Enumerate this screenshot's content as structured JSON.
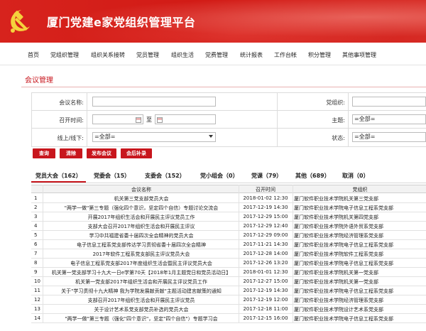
{
  "header": {
    "title": "厦门党建e家党组织管理平台"
  },
  "nav": {
    "items": [
      "首页",
      "党组织管理",
      "组织关系接转",
      "党员管理",
      "组织生活",
      "党费管理",
      "统计报表",
      "工作台帐",
      "积分管理",
      "其他事项管理"
    ]
  },
  "page": {
    "title": "会议管理"
  },
  "form": {
    "meeting_name_label": "会议名称:",
    "meeting_name_value": "",
    "org_label": "党组织:",
    "org_value": "",
    "time_label": "召开时间:",
    "time_to": "至",
    "theme_label": "主题:",
    "theme_value": "=全部=",
    "online_label": "线上/线下:",
    "online_value": "=全部=",
    "status_label": "状态:",
    "status_value": "=全部="
  },
  "buttons": {
    "query": "查询",
    "clear": "清除",
    "publish": "发布会议",
    "supplement": "会后补录"
  },
  "tabs": [
    "党员大会（162）",
    "党委会（15）",
    "支委会（152）",
    "党小组会（0）",
    "党课（79）",
    "其他（689）",
    "取消（0）"
  ],
  "table": {
    "headers": {
      "name": "会议名称",
      "time": "召开时间",
      "org": "党组织"
    },
    "rows": [
      {
        "num": "1",
        "name": "机关第三党支部党员大会",
        "time": "2018-01-02 12:30",
        "org": "厦门软件职业技术学院机关第三党支部"
      },
      {
        "num": "2",
        "name": "\"两学一做\"第三专题（强化四个意识，坚定四个自信）专题讨论交流会",
        "time": "2017-12-19 14:30",
        "org": "厦门软件职业技术学院电子信息工程系党支部"
      },
      {
        "num": "3",
        "name": "开展2017年组织生活会和开展民主评议党员工作",
        "time": "2017-12-29 15:00",
        "org": "厦门软件职业技术学院机关第四党支部"
      },
      {
        "num": "4",
        "name": "支部大会召开2017年组织生活会和开展民主评议",
        "time": "2017-12-29 12:40",
        "org": "厦门软件职业技术学院外语外贸系党支部"
      },
      {
        "num": "5",
        "name": "学习中共福建省委十届四次全会精神的党员大会",
        "time": "2017-12-29 09:00",
        "org": "厦门软件职业技术学院经济管理系党支部"
      },
      {
        "num": "6",
        "name": "电子信息工程系党支部传达学习贯彻省委十届四次全会精神",
        "time": "2017-11-21 14:30",
        "org": "厦门软件职业技术学院电子信息工程系党支部"
      },
      {
        "num": "7",
        "name": "2017年软件工程系党支部民主评议党员大会",
        "time": "2017-12-28 14:00",
        "org": "厦门软件职业技术学院软件工程系党支部"
      },
      {
        "num": "8",
        "name": "电子信息工程系党支部2017年度组织生活会暨民主评议党员大会",
        "time": "2017-12-26 13:20",
        "org": "厦门软件职业技术学院电子信息工程系党支部"
      },
      {
        "num": "9",
        "name": "机关第一党支部学习十九大一日e学第70天【2018年1月主题党日和党员活动日】",
        "time": "2018-01-01 12:30",
        "org": "厦门软件职业技术学院机关第一党支部"
      },
      {
        "num": "10",
        "name": "机关第一党支部2017年组织生活会和开展民主评议党员工作",
        "time": "2017-12-27 15:00",
        "org": "厦门软件职业技术学院机关第一党支部"
      },
      {
        "num": "11",
        "name": "关于\"学习贯彻十九大精神 我为学院发展献贡献\"主题活动建言献策的通知",
        "time": "2017-12-19 14:30",
        "org": "厦门软件职业技术学院电子信息工程系党支部"
      },
      {
        "num": "12",
        "name": "支部召开2017年组织生活会和开展民主评议党员",
        "time": "2017-12-19 12:00",
        "org": "厦门软件职业技术学院经济管理系党支部"
      },
      {
        "num": "13",
        "name": "关于设计艺术系党支部党员补选的党员大会",
        "time": "2017-12-18 11:00",
        "org": "厦门软件职业技术学院设计艺术系党支部"
      },
      {
        "num": "14",
        "name": "\"两学一做\"第三专题（强化\"四个意识\"，坚定\"四个自信\"）专题学习会",
        "time": "2017-12-15 16:00",
        "org": "厦门软件职业技术学院电子信息工程系党支部"
      }
    ]
  }
}
